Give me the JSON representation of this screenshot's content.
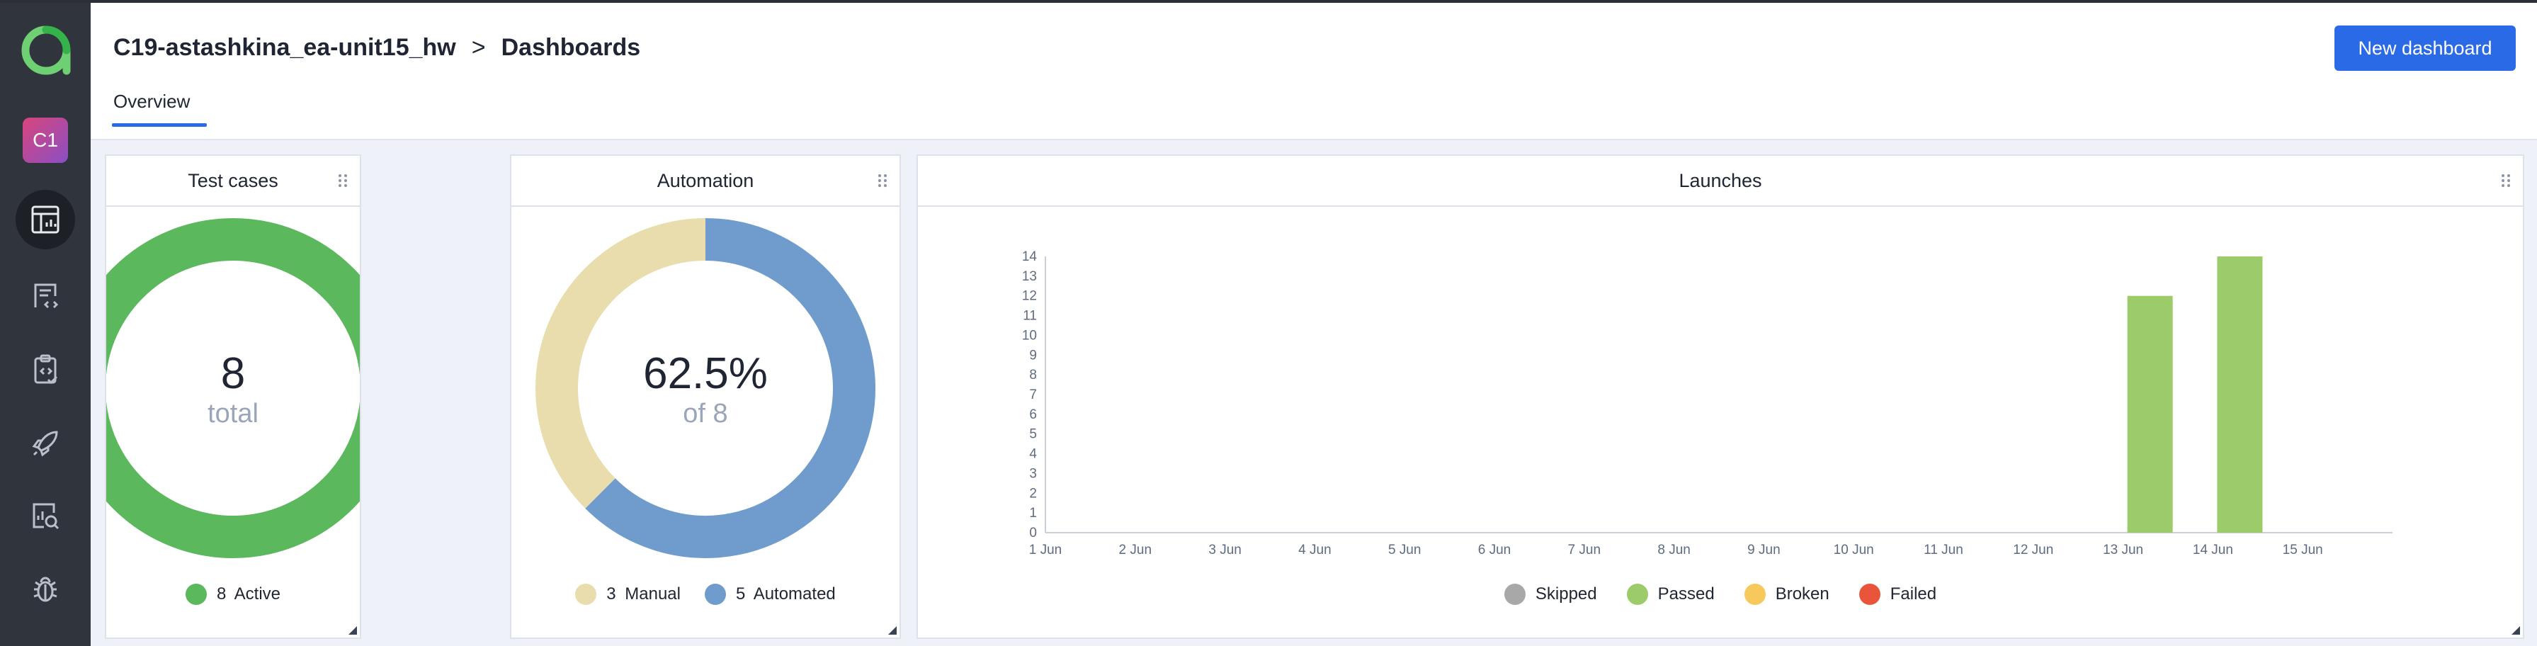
{
  "sidebar": {
    "project_badge": "C1",
    "items": [
      {
        "icon": "dashboard-icon",
        "active": true
      },
      {
        "icon": "code-document-icon",
        "active": false
      },
      {
        "icon": "clipboard-check-icon",
        "active": false
      },
      {
        "icon": "rocket-icon",
        "active": false
      },
      {
        "icon": "report-search-icon",
        "active": false
      },
      {
        "icon": "bug-icon",
        "active": false
      }
    ]
  },
  "header": {
    "project": "C19-astashkina_ea-unit15_hw",
    "separator": ">",
    "page": "Dashboards",
    "new_button": "New dashboard",
    "tab": "Overview"
  },
  "widgets": {
    "test_cases": {
      "title": "Test cases",
      "value": "8",
      "sub": "total",
      "legend": [
        {
          "count": "8",
          "label": "Active",
          "color": "#5cb85c"
        }
      ],
      "chart_data": {
        "type": "pie",
        "labels": [
          "Active"
        ],
        "values": [
          8
        ],
        "colors": [
          "#5cb85c"
        ]
      }
    },
    "automation": {
      "title": "Automation",
      "value": "62.5%",
      "sub": "of 8",
      "legend": [
        {
          "count": "3",
          "label": "Manual",
          "color": "#e9ddad"
        },
        {
          "count": "5",
          "label": "Automated",
          "color": "#6f9bcd"
        }
      ],
      "chart_data": {
        "type": "pie",
        "labels": [
          "Manual",
          "Automated"
        ],
        "values": [
          3,
          5
        ],
        "colors": [
          "#e9ddad",
          "#6f9bcd"
        ]
      }
    },
    "launches": {
      "title": "Launches",
      "legend": [
        {
          "label": "Skipped",
          "color": "#a8a8a8"
        },
        {
          "label": "Passed",
          "color": "#9ccc6a"
        },
        {
          "label": "Broken",
          "color": "#f7c95c"
        },
        {
          "label": "Failed",
          "color": "#e8553b"
        }
      ],
      "chart_data": {
        "type": "bar",
        "categories": [
          "1 Jun",
          "2 Jun",
          "3 Jun",
          "4 Jun",
          "5 Jun",
          "6 Jun",
          "7 Jun",
          "8 Jun",
          "9 Jun",
          "10 Jun",
          "11 Jun",
          "12 Jun",
          "13 Jun",
          "14 Jun",
          "15 Jun"
        ],
        "series": [
          {
            "name": "Passed",
            "values": [
              0,
              0,
              0,
              0,
              0,
              0,
              0,
              0,
              0,
              0,
              0,
              0,
              12,
              14,
              0
            ]
          }
        ],
        "ylim": [
          0,
          14
        ],
        "yticks": [
          "0",
          "1",
          "2",
          "3",
          "4",
          "5",
          "6",
          "7",
          "8",
          "9",
          "10",
          "11",
          "12",
          "13",
          "14"
        ]
      }
    }
  }
}
